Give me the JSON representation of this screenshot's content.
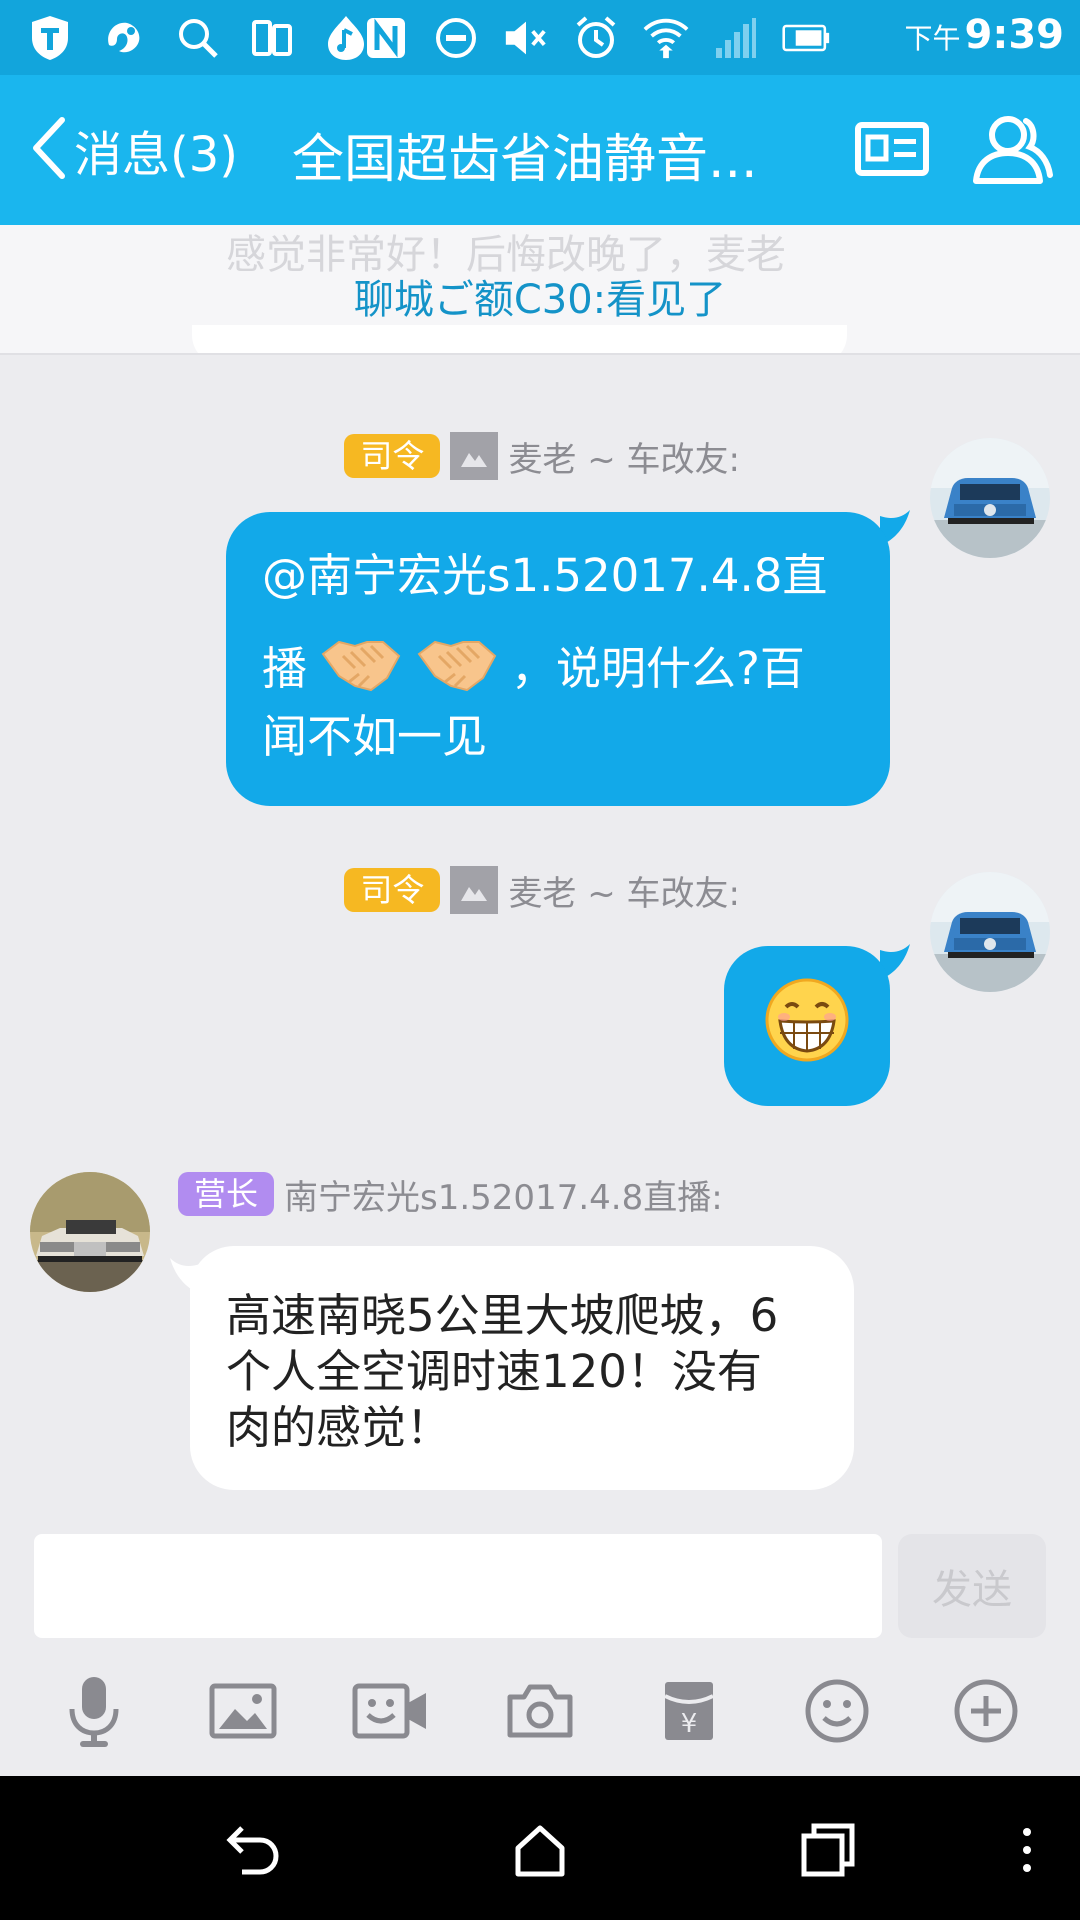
{
  "status_bar": {
    "ampm": "下午",
    "time": "9:39",
    "icons": [
      "shield-icon",
      "browser-icon",
      "search-icon",
      "phone-clone-icon",
      "music-icon",
      "nfc-icon",
      "dnd-icon",
      "mute-icon",
      "alarm-icon",
      "wifi-icon",
      "signal-icon",
      "battery-icon"
    ]
  },
  "header": {
    "back_label": "消息(3)",
    "title": "全国超齿省油静音...",
    "icons": [
      "profile-card-icon",
      "group-members-icon"
    ]
  },
  "notice": {
    "ghost_text": "感觉非常好！后悔改晚了，麦老",
    "text": "聊城ご额C30:看见了"
  },
  "messages": [
    {
      "badge": "司令",
      "sender": "麦老 ~ 车改友:",
      "line1": "@南宁宏光s1.52017.4.8直",
      "line2_prefix": "播",
      "line2_suffix": "，说明什么?百",
      "line3": "闻不如一见",
      "emojis": [
        "handshake",
        "handshake"
      ]
    },
    {
      "badge": "司令",
      "sender": "麦老 ~ 车改友:",
      "emoji": "grinning-face"
    },
    {
      "badge": "营长",
      "sender": "南宁宏光s1.52017.4.8直播:",
      "text_lines": [
        "高速南晓5公里大坡爬坡，6",
        "个人全空调时速120！没有",
        "肉的感觉！"
      ]
    }
  ],
  "composer": {
    "placeholder": "",
    "send_label": "发送",
    "tools": [
      "microphone-icon",
      "image-icon",
      "video-chat-icon",
      "camera-icon",
      "red-packet-icon",
      "emoji-icon",
      "plus-icon"
    ]
  },
  "colors": {
    "header": "#1ab6ee",
    "status_bar": "#12a5dc",
    "outgoing_bubble": "#12a9e9",
    "badge_gold": "#f6b822",
    "badge_purple": "#b18cf0"
  }
}
